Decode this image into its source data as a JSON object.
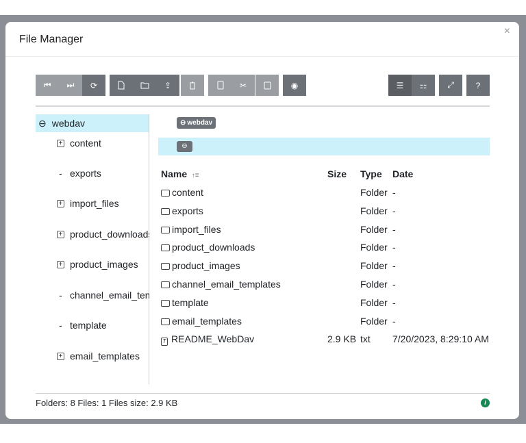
{
  "dialog": {
    "title": "File Manager",
    "close": "×"
  },
  "toolbar": {
    "icons": [
      "first-icon",
      "last-icon",
      "refresh-icon",
      "new-file-icon",
      "new-folder-icon",
      "upload-icon",
      "delete-icon",
      "copy-icon",
      "cut-icon",
      "paste-icon",
      "preview-icon",
      "list-view-icon",
      "grid-view-icon",
      "fullscreen-icon",
      "help-icon"
    ],
    "help": "?"
  },
  "tree": {
    "root": "webdav",
    "items": [
      {
        "label": "content",
        "expand": "plus"
      },
      {
        "label": "exports",
        "expand": "none"
      },
      {
        "label": "import_files",
        "expand": "plus"
      },
      {
        "label": "product_downloads",
        "expand": "plus"
      },
      {
        "label": "product_images",
        "expand": "plus"
      },
      {
        "label": "channel_email_templates",
        "expand": "none"
      },
      {
        "label": "template",
        "expand": "none"
      },
      {
        "label": "email_templates",
        "expand": "plus"
      }
    ]
  },
  "breadcrumb": "webdav",
  "table": {
    "headers": {
      "name": "Name",
      "size": "Size",
      "type": "Type",
      "date": "Date"
    },
    "rows": [
      {
        "name": "content",
        "size": "",
        "type": "Folder",
        "date": "-"
      },
      {
        "name": "exports",
        "size": "",
        "type": "Folder",
        "date": "-"
      },
      {
        "name": "import_files",
        "size": "",
        "type": "Folder",
        "date": "-"
      },
      {
        "name": "product_downloads",
        "size": "",
        "type": "Folder",
        "date": "-"
      },
      {
        "name": "product_images",
        "size": "",
        "type": "Folder",
        "date": "-"
      },
      {
        "name": "channel_email_templates",
        "size": "",
        "type": "Folder",
        "date": "-"
      },
      {
        "name": "template",
        "size": "",
        "type": "Folder",
        "date": "-"
      },
      {
        "name": "email_templates",
        "size": "",
        "type": "Folder",
        "date": "-"
      },
      {
        "name": "README_WebDav",
        "size": "2.9 KB",
        "type": "txt",
        "date": "7/20/2023, 8:29:10 AM"
      }
    ]
  },
  "status": "Folders: 8 Files: 1 Files size: 2.9 KB",
  "colors": {
    "selected": "#cdf1fa",
    "button_dark": "#6c7077",
    "button_light": "#9a9da2",
    "info": "#198754"
  }
}
